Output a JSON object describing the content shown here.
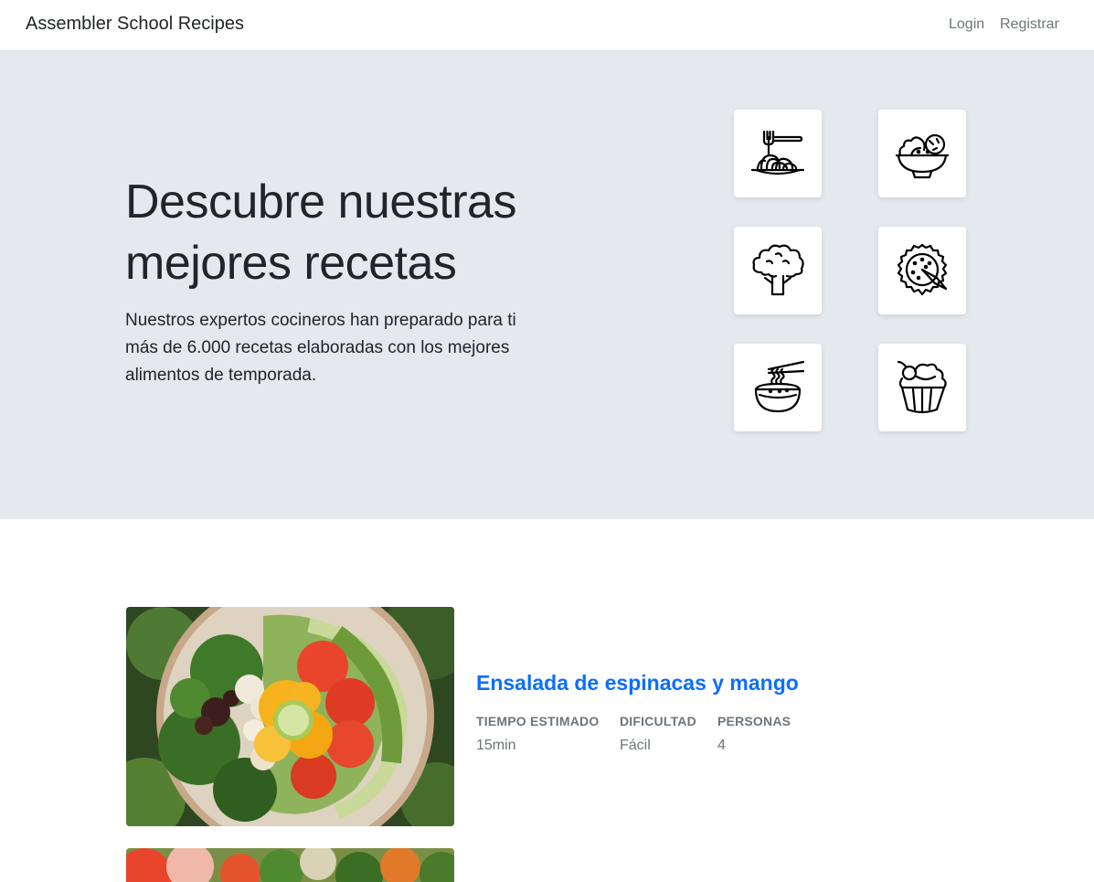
{
  "navbar": {
    "brand": "Assembler School Recipes",
    "links": [
      {
        "label": "Login"
      },
      {
        "label": "Registrar"
      }
    ]
  },
  "hero": {
    "title": "Descubre nuestras mejores recetas",
    "description": "Nuestros expertos cocineros han preparado para ti más de 6.000 recetas elaboradas con los mejores alimentos de temporada.",
    "tiles": [
      {
        "icon": "spaghetti-icon"
      },
      {
        "icon": "salad-bowl-icon"
      },
      {
        "icon": "broccoli-icon"
      },
      {
        "icon": "pie-icon"
      },
      {
        "icon": "noodle-bowl-icon"
      },
      {
        "icon": "cupcake-icon"
      }
    ]
  },
  "recipes": [
    {
      "title": "Ensalada de espinacas y mango",
      "meta": [
        {
          "label": "TIEMPO ESTIMADO",
          "value": "15min"
        },
        {
          "label": "DIFICULTAD",
          "value": "Fácil"
        },
        {
          "label": "PERSONAS",
          "value": "4"
        }
      ]
    }
  ],
  "colors": {
    "hero_bg": "#e5e8ed",
    "link_blue": "#0d6efd",
    "muted": "#6c757d"
  }
}
